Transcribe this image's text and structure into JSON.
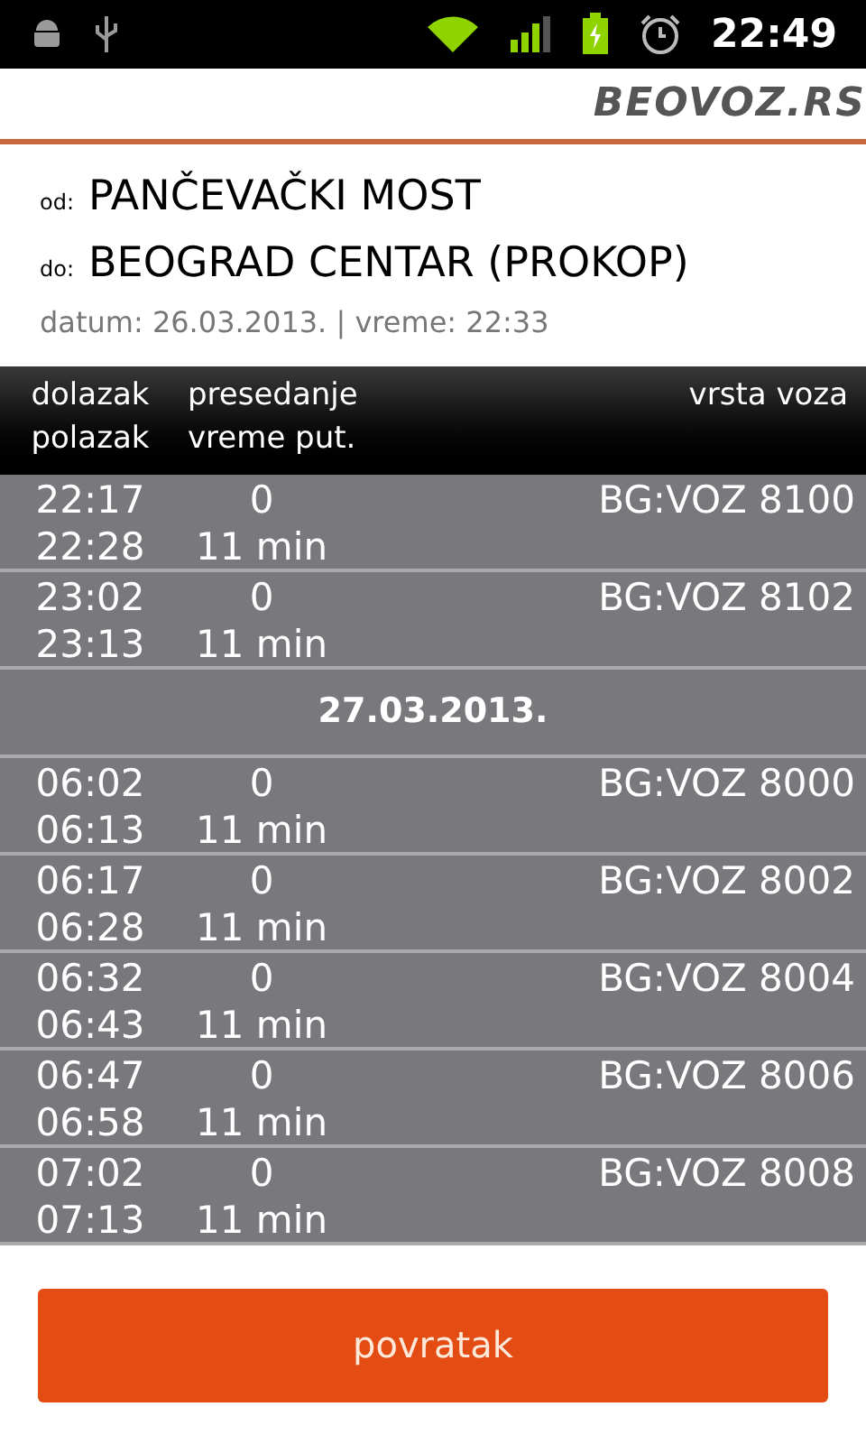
{
  "status_bar": {
    "time": "22:49"
  },
  "header": {
    "logo": "BEOVOZ.RS"
  },
  "route": {
    "from_label": "od:",
    "from": "PANČEVAČKI MOST",
    "to_label": "do:",
    "to": "BEOGRAD CENTAR (PROKOP)",
    "info": "datum: 26.03.2013. | vreme: 22:33"
  },
  "table": {
    "columns": [
      [
        "dolazak",
        "polazak"
      ],
      [
        "presedanje",
        "vreme put."
      ],
      [
        "vrsta voza"
      ]
    ],
    "rows": [
      {
        "kind": "train",
        "arrival": "22:17",
        "departure": "22:28",
        "transfers": "0",
        "duration": "11 min",
        "train": "BG:VOZ 8100"
      },
      {
        "kind": "train",
        "arrival": "23:02",
        "departure": "23:13",
        "transfers": "0",
        "duration": "11 min",
        "train": "BG:VOZ 8102"
      },
      {
        "kind": "date",
        "date": "27.03.2013."
      },
      {
        "kind": "train",
        "arrival": "06:02",
        "departure": "06:13",
        "transfers": "0",
        "duration": "11 min",
        "train": "BG:VOZ 8000"
      },
      {
        "kind": "train",
        "arrival": "06:17",
        "departure": "06:28",
        "transfers": "0",
        "duration": "11 min",
        "train": "BG:VOZ 8002"
      },
      {
        "kind": "train",
        "arrival": "06:32",
        "departure": "06:43",
        "transfers": "0",
        "duration": "11 min",
        "train": "BG:VOZ 8004"
      },
      {
        "kind": "train",
        "arrival": "06:47",
        "departure": "06:58",
        "transfers": "0",
        "duration": "11 min",
        "train": "BG:VOZ 8006"
      },
      {
        "kind": "train",
        "arrival": "07:02",
        "departure": "07:13",
        "transfers": "0",
        "duration": "11 min",
        "train": "BG:VOZ 8008"
      }
    ]
  },
  "back_button": "povratak"
}
